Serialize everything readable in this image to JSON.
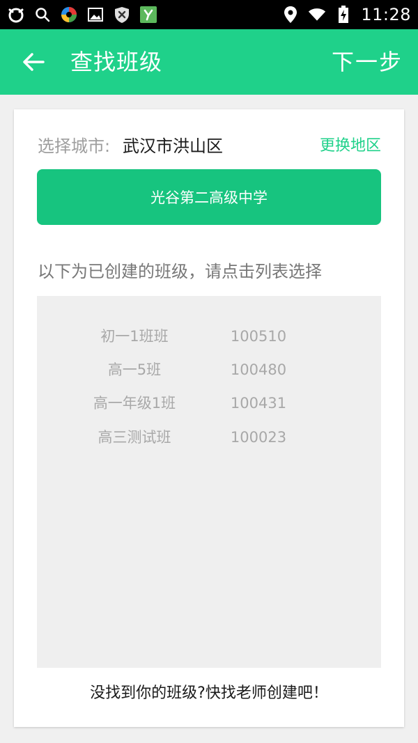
{
  "status_bar": {
    "time": "11:28",
    "left_icons": [
      "cat-face-icon",
      "search-icon",
      "color-wheel-icon",
      "image-icon",
      "shield-close-icon",
      "y-app-icon"
    ],
    "right_icons": [
      "location-icon",
      "wifi-icon",
      "battery-icon"
    ]
  },
  "app_bar": {
    "title": "查找班级",
    "next_label": "下一步",
    "accent_color": "#1fd18a"
  },
  "city": {
    "label": "选择城市:",
    "value": "武汉市洪山区",
    "change_label": "更换地区"
  },
  "school": {
    "name": "光谷第二高级中学"
  },
  "hint": "以下为已创建的班级，请点击列表选择",
  "classes": [
    {
      "name": "初一1班班",
      "code": "100510"
    },
    {
      "name": "高一5班",
      "code": "100480"
    },
    {
      "name": "高一年级1班",
      "code": "100431"
    },
    {
      "name": "高三测试班",
      "code": "100023"
    }
  ],
  "footer": "没找到你的班级?快找老师创建吧！"
}
